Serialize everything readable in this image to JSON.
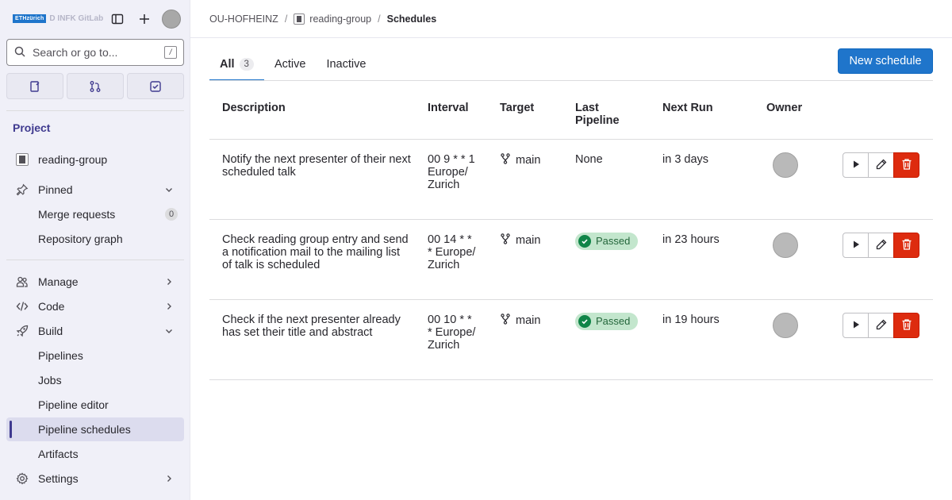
{
  "brand": {
    "logo_box": "ETHzürich",
    "logo_text": "D INFK GitLab"
  },
  "search": {
    "label": "Search or go to...",
    "shortcut": "/"
  },
  "sidebar": {
    "section_title": "Project",
    "project": "reading-group",
    "pinned": {
      "label": "Pinned",
      "items": [
        {
          "label": "Merge requests",
          "count": "0"
        },
        {
          "label": "Repository graph"
        }
      ]
    },
    "manage": "Manage",
    "code": "Code",
    "build": {
      "label": "Build",
      "items": [
        "Pipelines",
        "Jobs",
        "Pipeline editor",
        "Pipeline schedules",
        "Artifacts"
      ]
    },
    "settings": "Settings"
  },
  "breadcrumb": {
    "group": "OU-HOFHEINZ",
    "project": "reading-group",
    "current": "Schedules"
  },
  "tabs": [
    {
      "label": "All",
      "count": "3"
    },
    {
      "label": "Active"
    },
    {
      "label": "Inactive"
    }
  ],
  "new_schedule_label": "New schedule",
  "table": {
    "headers": {
      "description": "Description",
      "interval": "Interval",
      "target": "Target",
      "last_pipeline": "Last Pipeline",
      "next_run": "Next Run",
      "owner": "Owner"
    },
    "rows": [
      {
        "description": "Notify the next presenter of their next scheduled talk",
        "interval": "00 9 * * 1 Europe/ Zurich",
        "target": "main",
        "last_pipeline": "None",
        "next_run": "in 3 days"
      },
      {
        "description": "Check reading group entry and send a notification mail to the mailing list of talk is scheduled",
        "interval": "00 14 * * * Europe/ Zurich",
        "target": "main",
        "last_pipeline": "Passed",
        "next_run": "in 23 hours"
      },
      {
        "description": "Check if the next presenter already has set their title and abstract",
        "interval": "00 10 * * * Europe/ Zurich",
        "target": "main",
        "last_pipeline": "Passed",
        "next_run": "in 19 hours"
      }
    ]
  },
  "colors": {
    "primary": "#1f75cb",
    "danger": "#dd2b0e",
    "success": "#108548",
    "sidebar_bg": "#f0f0f8",
    "section_title": "#3f3a8f"
  }
}
